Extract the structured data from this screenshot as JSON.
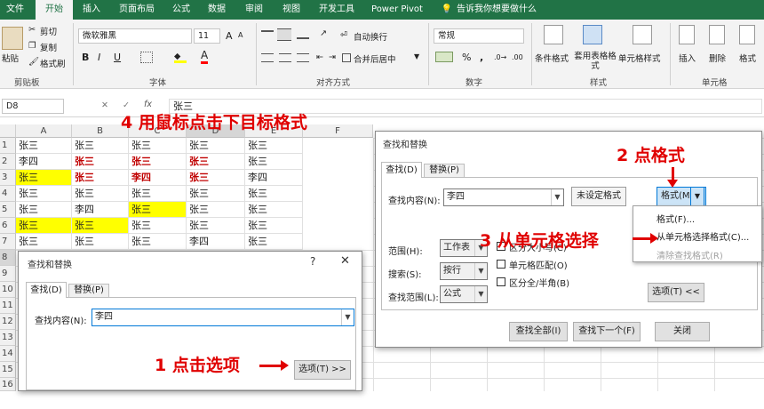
{
  "menu": {
    "tabs": [
      "文件",
      "开始",
      "插入",
      "页面布局",
      "公式",
      "数据",
      "审阅",
      "视图",
      "开发工具",
      "Power Pivot"
    ],
    "active": "开始",
    "tellme": "告诉我你想要做什么"
  },
  "ribbon": {
    "clipboard": {
      "paste": "粘贴",
      "cut": "剪切",
      "copy": "复制",
      "format_painter": "格式刷",
      "group": "剪贴板"
    },
    "font": {
      "name": "微软雅黑",
      "size": "11",
      "bold": "B",
      "italic": "I",
      "underline": "U",
      "color_letter": "A",
      "grow": "A",
      "shrink": "A",
      "group": "字体"
    },
    "align": {
      "wrap": "自动换行",
      "merge": "合并后居中",
      "group": "对齐方式"
    },
    "number": {
      "format": "常规",
      "percent": "%",
      "comma": ",",
      "group": "数字"
    },
    "styles": {
      "conditional": "条件格式",
      "table": "套用表格格式",
      "cell": "单元格样式",
      "group": "样式"
    },
    "cells": {
      "insert": "插入",
      "delete": "删除",
      "format": "格式",
      "group": "单元格"
    }
  },
  "formula_bar": {
    "name_box": "D8",
    "fx": "fx",
    "cancel": "✕",
    "enter": "✓",
    "value": "张三"
  },
  "sheet": {
    "columns": [
      "A",
      "B",
      "C",
      "D",
      "E",
      "F"
    ],
    "rows": [
      "1",
      "2",
      "3",
      "4",
      "5",
      "6",
      "7",
      "8",
      "9",
      "10",
      "11",
      "12",
      "13",
      "14",
      "15",
      "16"
    ],
    "cells": [
      [
        "张三",
        "张三",
        "张三",
        "张三",
        "张三"
      ],
      [
        "李四",
        "张三",
        "张三",
        "张三",
        "张三"
      ],
      [
        "张三",
        "张三",
        "李四",
        "张三",
        "李四"
      ],
      [
        "张三",
        "张三",
        "张三",
        "张三",
        "张三"
      ],
      [
        "张三",
        "李四",
        "张三",
        "张三",
        "张三"
      ],
      [
        "张三",
        "张三",
        "张三",
        "张三",
        "张三"
      ],
      [
        "张三",
        "张三",
        "张三",
        "李四",
        "张三"
      ]
    ],
    "row1_partial": [
      "张",
      "张",
      "张",
      "张"
    ]
  },
  "dialog_small": {
    "title": "查找和替换",
    "help": "?",
    "close": "✕",
    "tab_find": "查找(D)",
    "tab_replace": "替换(P)",
    "find_label": "查找内容(N):",
    "find_value": "李四",
    "options_btn": "选项(T) >>"
  },
  "dialog_large": {
    "title": "查找和替换",
    "tab_find": "查找(D)",
    "tab_replace": "替换(P)",
    "find_label": "查找内容(N):",
    "find_value": "李四",
    "no_format": "未设定格式",
    "format_btn": "格式(M)...",
    "scope_label": "范围(H):",
    "scope_value": "工作表",
    "search_label": "搜索(S):",
    "search_value": "按行",
    "lookin_label": "查找范围(L):",
    "lookin_value": "公式",
    "match_case": "区分大小写(C)",
    "match_cell": "单元格匹配(O)",
    "match_width": "区分全/半角(B)",
    "options_btn": "选项(T) <<",
    "find_all": "查找全部(I)",
    "find_next": "查找下一个(F)",
    "close_btn": "关闭",
    "menu": [
      "格式(F)...",
      "从单元格选择格式(C)...",
      "清除查找格式(R)"
    ]
  },
  "annotations": {
    "a1": "1 点击选项",
    "a2": "2 点格式",
    "a3": "3 从单元格选择",
    "a4": "4 用鼠标点击下目标格式"
  },
  "colors": {
    "excel_green": "#217346",
    "annotation_red": "#e00000",
    "highlight": "#ffff00"
  }
}
